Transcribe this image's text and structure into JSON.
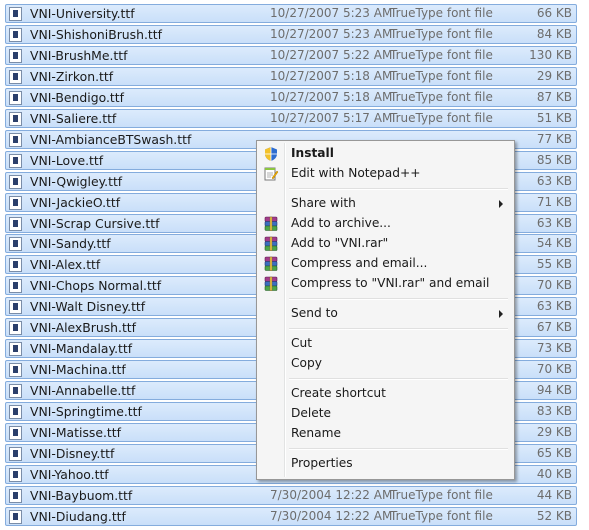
{
  "files": [
    {
      "name": "VNI-University.ttf",
      "date": "10/27/2007 5:23 AM",
      "type": "TrueType font file",
      "size": "66 KB"
    },
    {
      "name": "VNI-ShishoniBrush.ttf",
      "date": "10/27/2007 5:23 AM",
      "type": "TrueType font file",
      "size": "84 KB"
    },
    {
      "name": "VNI-BrushMe.ttf",
      "date": "10/27/2007 5:22 AM",
      "type": "TrueType font file",
      "size": "130 KB"
    },
    {
      "name": "VNI-Zirkon.ttf",
      "date": "10/27/2007 5:18 AM",
      "type": "TrueType font file",
      "size": "29 KB"
    },
    {
      "name": "VNI-Bendigo.ttf",
      "date": "10/27/2007 5:18 AM",
      "type": "TrueType font file",
      "size": "87 KB"
    },
    {
      "name": "VNI-Saliere.ttf",
      "date": "10/27/2007 5:17 AM",
      "type": "TrueType font file",
      "size": "51 KB"
    },
    {
      "name": "VNI-AmbianceBTSwash.ttf",
      "date": "",
      "type": "",
      "size": "77 KB"
    },
    {
      "name": "VNI-Love.ttf",
      "date": "",
      "type": "",
      "size": "85 KB"
    },
    {
      "name": "VNI-Qwigley.ttf",
      "date": "",
      "type": "",
      "size": "63 KB"
    },
    {
      "name": "VNI-JackieO.ttf",
      "date": "",
      "type": "",
      "size": "71 KB"
    },
    {
      "name": "VNI-Scrap Cursive.ttf",
      "date": "",
      "type": "",
      "size": "63 KB"
    },
    {
      "name": "VNI-Sandy.ttf",
      "date": "",
      "type": "",
      "size": "54 KB"
    },
    {
      "name": "VNI-Alex.ttf",
      "date": "",
      "type": "",
      "size": "55 KB"
    },
    {
      "name": "VNI-Chops Normal.ttf",
      "date": "",
      "type": "",
      "size": "70 KB"
    },
    {
      "name": "VNI-Walt Disney.ttf",
      "date": "",
      "type": "",
      "size": "63 KB"
    },
    {
      "name": "VNI-AlexBrush.ttf",
      "date": "",
      "type": "",
      "size": "67 KB"
    },
    {
      "name": "VNI-Mandalay.ttf",
      "date": "",
      "type": "",
      "size": "73 KB"
    },
    {
      "name": "VNI-Machina.ttf",
      "date": "",
      "type": "",
      "size": "70 KB"
    },
    {
      "name": "VNI-Annabelle.ttf",
      "date": "",
      "type": "",
      "size": "94 KB"
    },
    {
      "name": "VNI-Springtime.ttf",
      "date": "",
      "type": "",
      "size": "83 KB"
    },
    {
      "name": "VNI-Matisse.ttf",
      "date": "",
      "type": "",
      "size": "29 KB"
    },
    {
      "name": "VNI-Disney.ttf",
      "date": "",
      "type": "",
      "size": "65 KB"
    },
    {
      "name": "VNI-Yahoo.ttf",
      "date": "",
      "type": "",
      "size": "40 KB"
    },
    {
      "name": "VNI-Baybuom.ttf",
      "date": "7/30/2004 12:22 AM",
      "type": "TrueType font file",
      "size": "44 KB"
    },
    {
      "name": "VNI-Diudang.ttf",
      "date": "7/30/2004 12:22 AM",
      "type": "TrueType font file",
      "size": "52 KB"
    }
  ],
  "context_menu": {
    "items": [
      {
        "label": "Install",
        "bold": true,
        "icon": "shield-icon"
      },
      {
        "label": "Edit with Notepad++",
        "icon": "notepad-icon"
      },
      {
        "separator": true
      },
      {
        "label": "Share with",
        "submenu": true
      },
      {
        "label": "Add to archive...",
        "icon": "winrar-icon"
      },
      {
        "label": "Add to \"VNI.rar\"",
        "icon": "winrar-icon"
      },
      {
        "label": "Compress and email...",
        "icon": "winrar-icon"
      },
      {
        "label": "Compress to \"VNI.rar\" and email",
        "icon": "winrar-icon"
      },
      {
        "separator": true
      },
      {
        "label": "Send to",
        "submenu": true
      },
      {
        "separator": true
      },
      {
        "label": "Cut"
      },
      {
        "label": "Copy"
      },
      {
        "separator": true
      },
      {
        "label": "Create shortcut"
      },
      {
        "label": "Delete"
      },
      {
        "label": "Rename"
      },
      {
        "separator": true
      },
      {
        "label": "Properties"
      }
    ]
  }
}
